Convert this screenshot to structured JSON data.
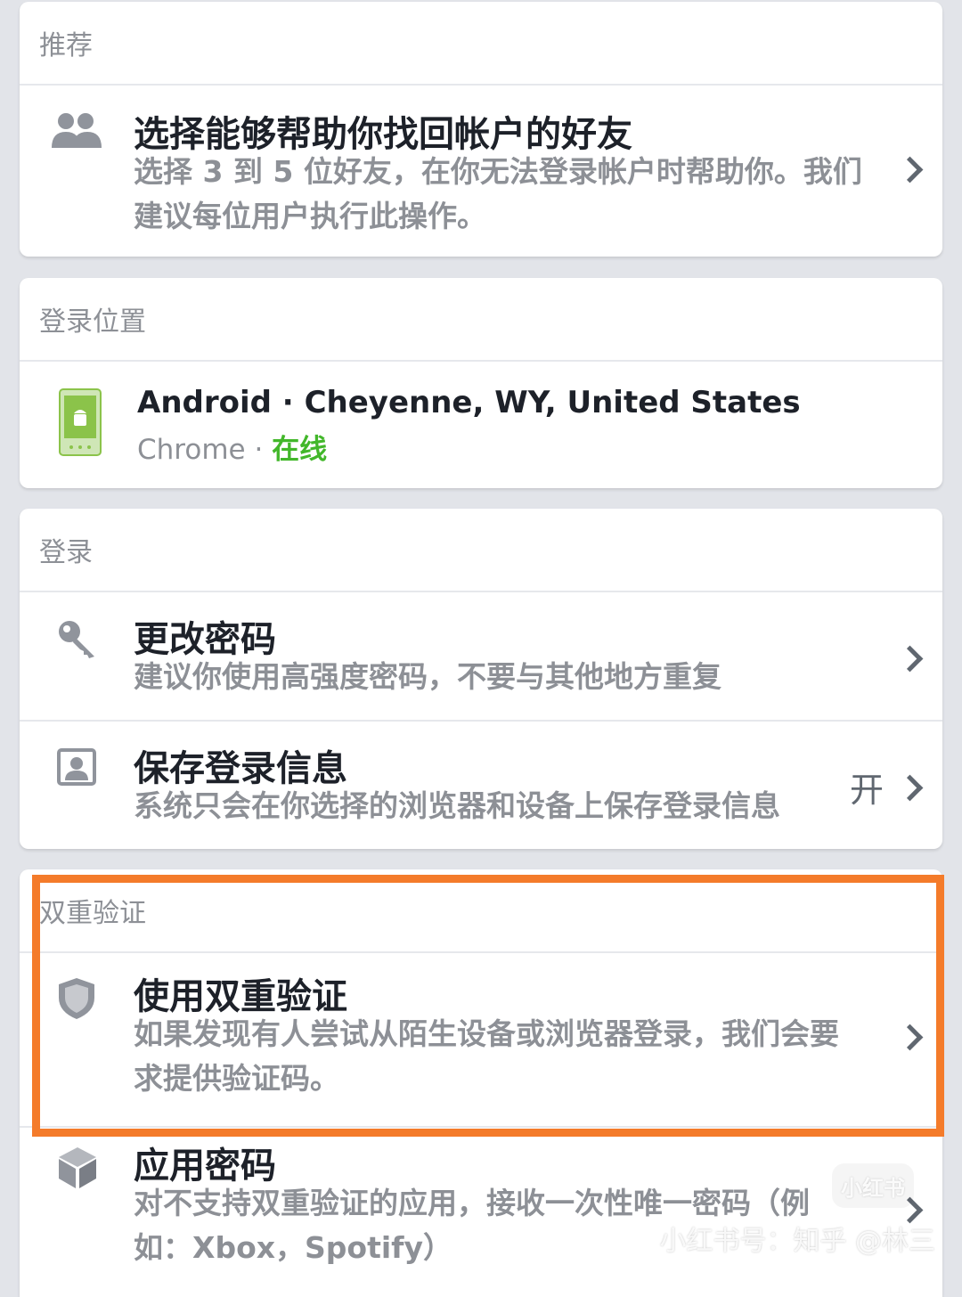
{
  "sections": {
    "recommended": {
      "header": "推荐",
      "item": {
        "icon": "friends-icon",
        "title": "选择能够帮助你找回帐户的好友",
        "subtitle_line1": "选择 3 到 5 位好友，在你无法登录帐户时帮助你。我们",
        "subtitle_line2": "建议每位用户执行此操作。"
      }
    },
    "login_location": {
      "header": "登录位置",
      "item": {
        "icon": "android-phone-icon",
        "title": "Android · Cheyenne, WY, United States",
        "browser": "Chrome",
        "separator": " · ",
        "status": "在线",
        "status_color": "#42b72a"
      }
    },
    "login": {
      "header": "登录",
      "items": [
        {
          "icon": "key-icon",
          "title": "更改密码",
          "subtitle": "建议你使用高强度密码，不要与其他地方重复"
        },
        {
          "icon": "profile-card-icon",
          "title": "保存登录信息",
          "subtitle": "系统只会在你选择的浏览器和设备上保存登录信息",
          "status": "开"
        }
      ]
    },
    "two_factor": {
      "header": "双重验证",
      "items": [
        {
          "icon": "shield-icon",
          "title": "使用双重验证",
          "subtitle_line1": "如果发现有人尝试从陌生设备或浏览器登录，我们会要",
          "subtitle_line2": "求提供验证码。"
        },
        {
          "icon": "cube-icon",
          "title": "应用密码",
          "subtitle_line1": "对不支持双重验证的应用，接收一次性唯一密码（例",
          "subtitle_line2": "如：Xbox，Spotify）"
        }
      ]
    }
  },
  "highlight_color": "#f47b2a",
  "watermark": {
    "badge": "小红书",
    "text": "小红书号：知乎 @林三"
  }
}
